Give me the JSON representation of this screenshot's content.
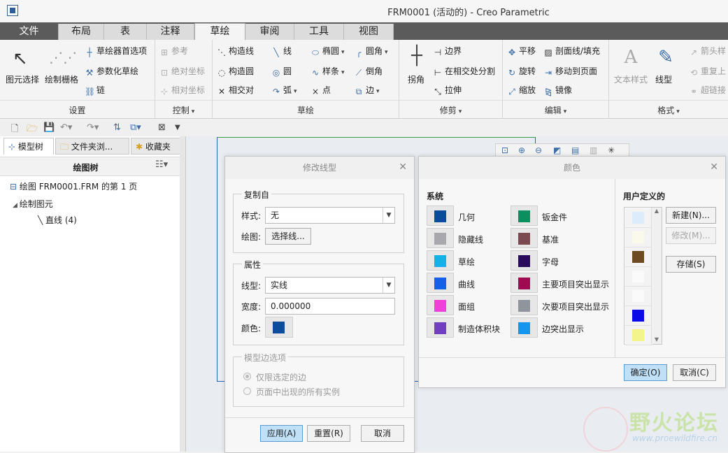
{
  "window": {
    "title": "FRM0001 (活动的) - Creo Parametric"
  },
  "tabs": [
    {
      "label": "文件"
    },
    {
      "label": "布局"
    },
    {
      "label": "表"
    },
    {
      "label": "注释"
    },
    {
      "label": "草绘"
    },
    {
      "label": "审阅"
    },
    {
      "label": "工具"
    },
    {
      "label": "视图"
    }
  ],
  "ribbon": {
    "settings": {
      "label": "设置",
      "select": "图元选择",
      "grid": "绘制栅格",
      "prefs": "草绘器首选项",
      "param": "参数化草绘",
      "chain": "链"
    },
    "control": {
      "label": "控制",
      "ref": "参考",
      "abs": "绝对坐标",
      "rel": "相对坐标"
    },
    "sketch": {
      "label": "草绘",
      "construct_line": "构造线",
      "construct_circle": "构造圆",
      "intersect": "相交对",
      "line": "线",
      "circle": "圆",
      "arc": "弧",
      "ellipse": "椭圆",
      "spline": "样条",
      "point": "点",
      "fillet": "圆角",
      "chamfer": "倒角",
      "edge": "边"
    },
    "trim": {
      "label": "修剪",
      "corner": "拐角",
      "boundary": "边界",
      "split": "在相交处分割",
      "stretch": "拉伸"
    },
    "edit": {
      "label": "编辑",
      "translate": "平移",
      "rotate": "旋转",
      "scale": "缩放",
      "hatch": "剖面线/填充",
      "move_page": "移动到页面",
      "mirror": "镜像"
    },
    "format": {
      "label": "格式",
      "text_style": "文本样式",
      "line_style": "线型",
      "arrow": "箭头样",
      "repeat": "重复上",
      "hyperlink": "超链接"
    }
  },
  "left_panel": {
    "tabs": [
      "模型树",
      "文件夹浏...",
      "收藏夹"
    ],
    "tree_title": "绘图树",
    "items": [
      "绘图 FRM0001.FRM 的第 1 页",
      "绘制图元",
      "直线 (4)"
    ]
  },
  "dialog_linestyle": {
    "title": "修改线型",
    "copy_from": {
      "legend": "复制自",
      "style_label": "样式:",
      "style_value": "无",
      "draw_label": "绘图:",
      "select_lines": "选择线..."
    },
    "attributes": {
      "legend": "属性",
      "linetype_label": "线型:",
      "linetype_value": "实线",
      "width_label": "宽度:",
      "width_value": "0.000000",
      "color_label": "颜色:"
    },
    "model_edges": {
      "legend": "模型边选项",
      "opt1": "仅限选定的边",
      "opt2": "页面中出现的所有实例"
    },
    "buttons": {
      "apply": "应用(A)",
      "reset": "重置(R)",
      "cancel": "取消"
    }
  },
  "dialog_color": {
    "title": "颜色",
    "system_label": "系统",
    "user_label": "用户定义的",
    "system_colors": [
      {
        "name": "几何",
        "color": "#0b4c9c"
      },
      {
        "name": "隐藏线",
        "color": "#a8a8ac"
      },
      {
        "name": "草绘",
        "color": "#14b0e8"
      },
      {
        "name": "曲线",
        "color": "#1460e8"
      },
      {
        "name": "面组",
        "color": "#f040d8"
      },
      {
        "name": "制造体积块",
        "color": "#7040c0"
      },
      {
        "name": "钣金件",
        "color": "#0a9060"
      },
      {
        "name": "基准",
        "color": "#7a4a50"
      },
      {
        "name": "字母",
        "color": "#2a0a5a"
      },
      {
        "name": "主要项目突出显示",
        "color": "#a00a50"
      },
      {
        "name": "次要项目突出显示",
        "color": "#90949c"
      },
      {
        "name": "边突出显示",
        "color": "#1496f0"
      }
    ],
    "user_colors": [
      "#dcecfa",
      "#fafaec",
      "#6e4a22",
      "#fafafa",
      "#fafafa",
      "#0a0ae8",
      "#f4f48c"
    ],
    "buttons": {
      "new": "新建(N)...",
      "modify": "修改(M)...",
      "save": "存储(S)",
      "ok": "确定(O)",
      "cancel": "取消(C)"
    }
  },
  "watermark": {
    "text": "野火论坛",
    "url": "www.proewildfire.cn"
  }
}
